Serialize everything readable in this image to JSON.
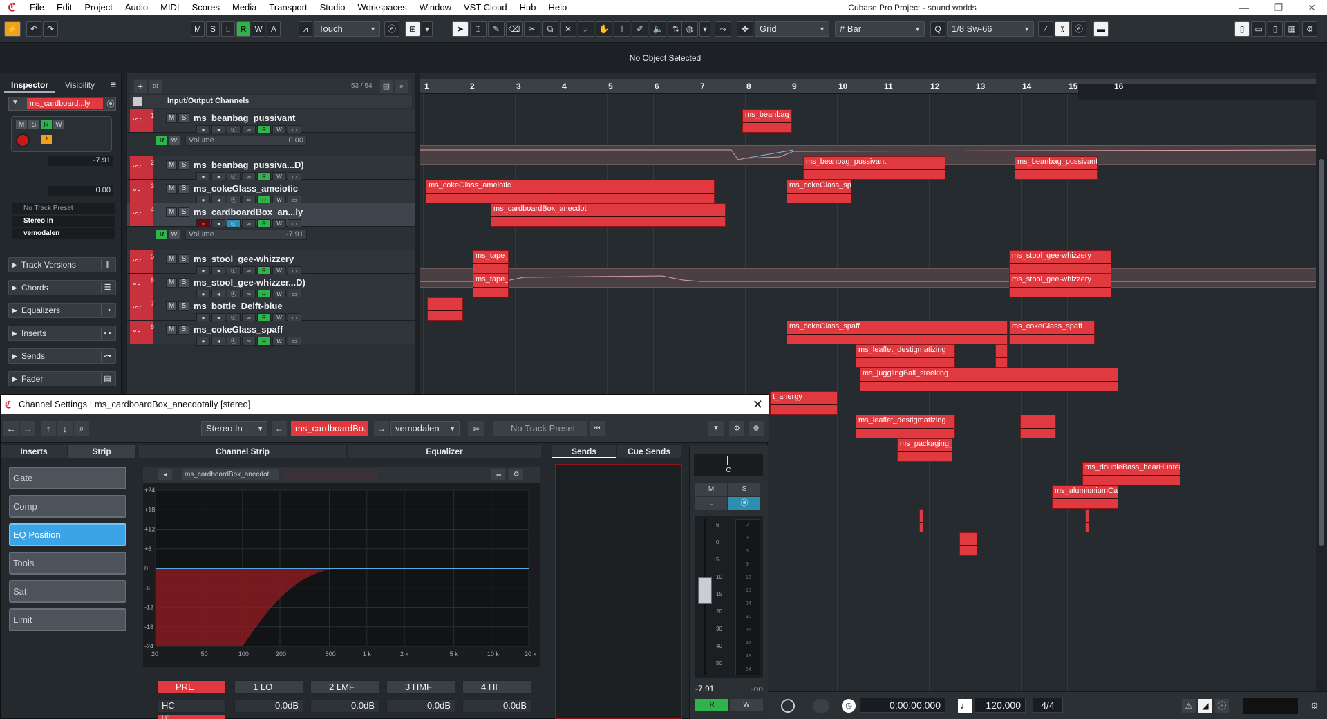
{
  "menubar": {
    "items": [
      "File",
      "Edit",
      "Project",
      "Audio",
      "MIDI",
      "Scores",
      "Media",
      "Transport",
      "Studio",
      "Workspaces",
      "Window",
      "VST Cloud",
      "Hub",
      "Help"
    ],
    "title": "Cubase Pro Project - sound worlds"
  },
  "toolbar": {
    "mode_buttons": [
      "M",
      "S",
      "L",
      "R",
      "W",
      "A"
    ],
    "automation_mode": "Touch",
    "grid_type": "Grid",
    "grid_value": "Bar",
    "quantize": "1/8 Sw-66"
  },
  "status": {
    "info_line": "No Object Selected"
  },
  "inspector": {
    "tabs": [
      "Inspector",
      "Visibility"
    ],
    "track_name": "ms_cardboard...ly",
    "volume": "-7.91",
    "pan": "0.00",
    "preset": "No Track Preset",
    "input": "Stereo In",
    "output": "vemodalen",
    "sections": [
      "Track Versions",
      "Chords",
      "Equalizers",
      "Inserts",
      "Sends",
      "Fader"
    ]
  },
  "tracklist": {
    "folder_label": "Input/Output Channels",
    "count": "53 / 54",
    "tracks": [
      {
        "num": "1",
        "name": "ms_beanbag_pussivant",
        "lane": {
          "param": "Volume",
          "value": "0.00"
        }
      },
      {
        "num": "2",
        "name": "ms_beanbag_pussiva...D)"
      },
      {
        "num": "3",
        "name": "ms_cokeGlass_ameiotic"
      },
      {
        "num": "4",
        "name": "ms_cardboardBox_an...ly",
        "lane": {
          "param": "Volume",
          "value": "-7.91"
        }
      },
      {
        "num": "5",
        "name": "ms_stool_gee-whizzery"
      },
      {
        "num": "6",
        "name": "ms_stool_gee-whizzer...D)"
      },
      {
        "num": "7",
        "name": "ms_bottle_Delft-blue"
      },
      {
        "num": "8",
        "name": "ms_cokeGlass_spaff"
      }
    ]
  },
  "ruler": {
    "bars": [
      "1",
      "2",
      "3",
      "4",
      "5",
      "6",
      "7",
      "8",
      "9",
      "10",
      "11",
      "12",
      "13",
      "14",
      "15",
      "16"
    ]
  },
  "events": [
    {
      "label": "ms_beanbag_"
    },
    {
      "label": "ms_beanbag_pussivant"
    },
    {
      "label": "ms_beanbag_pussivant"
    },
    {
      "label": "ms_cokeGlass_ameiotic"
    },
    {
      "label": "ms_cokeGlass_spa"
    },
    {
      "label": "ms_cardboardBox_anecdot"
    },
    {
      "label": "ms_tape_l"
    },
    {
      "label": "ms_stool_gee-whizzery"
    },
    {
      "label": "ms_tape_l"
    },
    {
      "label": "ms_stool_gee-whizzery"
    },
    {
      "label": ""
    },
    {
      "label": "ms_cokeGlass_spaff"
    },
    {
      "label": "ms_cokeGlass_spaff"
    },
    {
      "label": "ms_leaflet_destigmatizing"
    },
    {
      "label": ""
    },
    {
      "label": "ms_jugglingBall_steeking"
    },
    {
      "label": "t_anergy"
    },
    {
      "label": "ms_leaflet_destigmatizing"
    },
    {
      "label": ""
    },
    {
      "label": "ms_packaging_"
    },
    {
      "label": "ms_doubleBass_bearHunter"
    },
    {
      "label": "ms_alumiuniumCan"
    },
    {
      "label": ""
    },
    {
      "label": ""
    },
    {
      "label": ""
    }
  ],
  "transport": {
    "time": "0:00:00.000",
    "tempo": "120.000",
    "signature": "4/4"
  },
  "channel_window": {
    "title": "Channel Settings : ms_cardboardBox_anecdotally [stereo]",
    "input": "Stereo In",
    "channel": "ms_cardboardBo.",
    "output": "vemodalen",
    "preset": "No Track Preset",
    "left_tabs": [
      "Inserts",
      "Strip"
    ],
    "strip_modules": [
      "Gate",
      "Comp",
      "EQ Position",
      "Tools",
      "Sat",
      "Limit"
    ],
    "panels": {
      "channel_strip": "Channel Strip",
      "equalizer": "Equalizer",
      "sends": "Sends",
      "cue_sends": "Cue Sends"
    },
    "eq_name": "ms_cardboardBox_anecdot",
    "eq_db_labels": [
      "+24",
      "+18",
      "+12",
      "+6",
      "0",
      "-6",
      "-12",
      "-18",
      "-24"
    ],
    "eq_freq_labels": [
      "20",
      "50",
      "100",
      "200",
      "500",
      "1 k",
      "2 k",
      "5 k",
      "10 k",
      "20 k"
    ],
    "bands": [
      {
        "label": "PRE"
      },
      {
        "label": "1 LO",
        "value": "0.0dB"
      },
      {
        "label": "2 LMF",
        "value": "0.0dB"
      },
      {
        "label": "3 HMF",
        "value": "0.0dB"
      },
      {
        "label": "4 HI",
        "value": "0.0dB"
      }
    ],
    "hc_label": "HC",
    "lc_label": "LC",
    "fader_value": "-7.91",
    "fader_peak": "-oo",
    "pan_label": "C",
    "fader_scale": [
      "6",
      "0",
      "5",
      "10",
      "15",
      "20",
      "30",
      "40",
      "50"
    ],
    "meter_scale": [
      "0",
      "3",
      "6",
      "9",
      "12",
      "18",
      "24",
      "30",
      "36",
      "42",
      "48",
      "54"
    ]
  },
  "colors": {
    "event_red": "#e03a40",
    "accent_blue": "#3aa4e6",
    "green": "#2fb34a"
  }
}
